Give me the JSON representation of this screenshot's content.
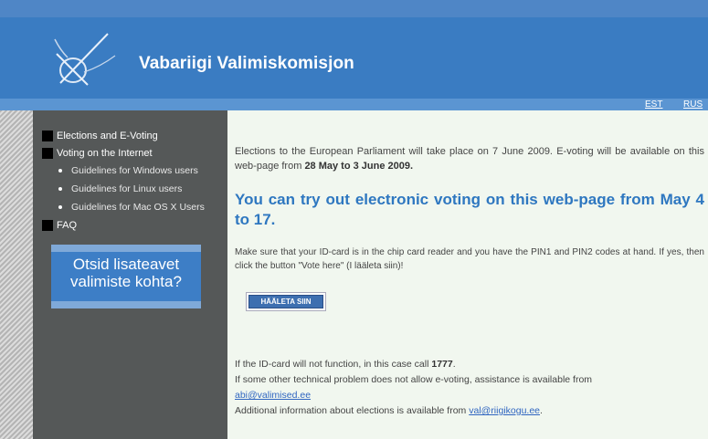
{
  "header": {
    "title": "Vabariigi Valimiskomisjon",
    "lang_links": [
      "EST",
      "RUS"
    ]
  },
  "sidebar": {
    "items": [
      {
        "label": "Elections and E-Voting"
      },
      {
        "label": "Voting on the Internet"
      }
    ],
    "subitems": [
      {
        "label": "Guidelines for Windows users"
      },
      {
        "label": "Guidelines for Linux users"
      },
      {
        "label": "Guidelines for Mac OS X Users"
      }
    ],
    "faq": "FAQ",
    "promo": {
      "line1": "Otsid lisateavet",
      "line2": "valimiste kohta?"
    }
  },
  "main": {
    "intro_text": "Elections to the European Parliament will take place on 7 June 2009. E-voting will be available on this web-page from",
    "intro_bold": "28 May to 3 June 2009.",
    "headline": "You can try out electronic voting on this web-page from May 4 to 17.",
    "instructions": "Make sure that your ID-card is in the chip card reader and you have the PIN1 and PIN2 codes at hand. If yes, then click the button \"Vote here\" (I lääleta siin)!",
    "vote_button": "HÄÄLETA SIIN",
    "idcard_text": "If the ID-card will not function, in this case call",
    "idcard_number": "1777",
    "tech_text": "If some other technical problem does not allow e-voting, assistance is available from",
    "tech_email": "abi@valimised.ee",
    "info_text": "Additional information about elections is available from",
    "info_email": "val@riigikogu.ee",
    "info_end": "."
  },
  "icons": {
    "logo": "election-logo-icon",
    "checkbox": "square-bullet-icon"
  },
  "colors": {
    "header": "#3a7cc2",
    "sidebar": "#555858",
    "content_bg": "#f1f7ef",
    "headline": "#2e77c0"
  }
}
